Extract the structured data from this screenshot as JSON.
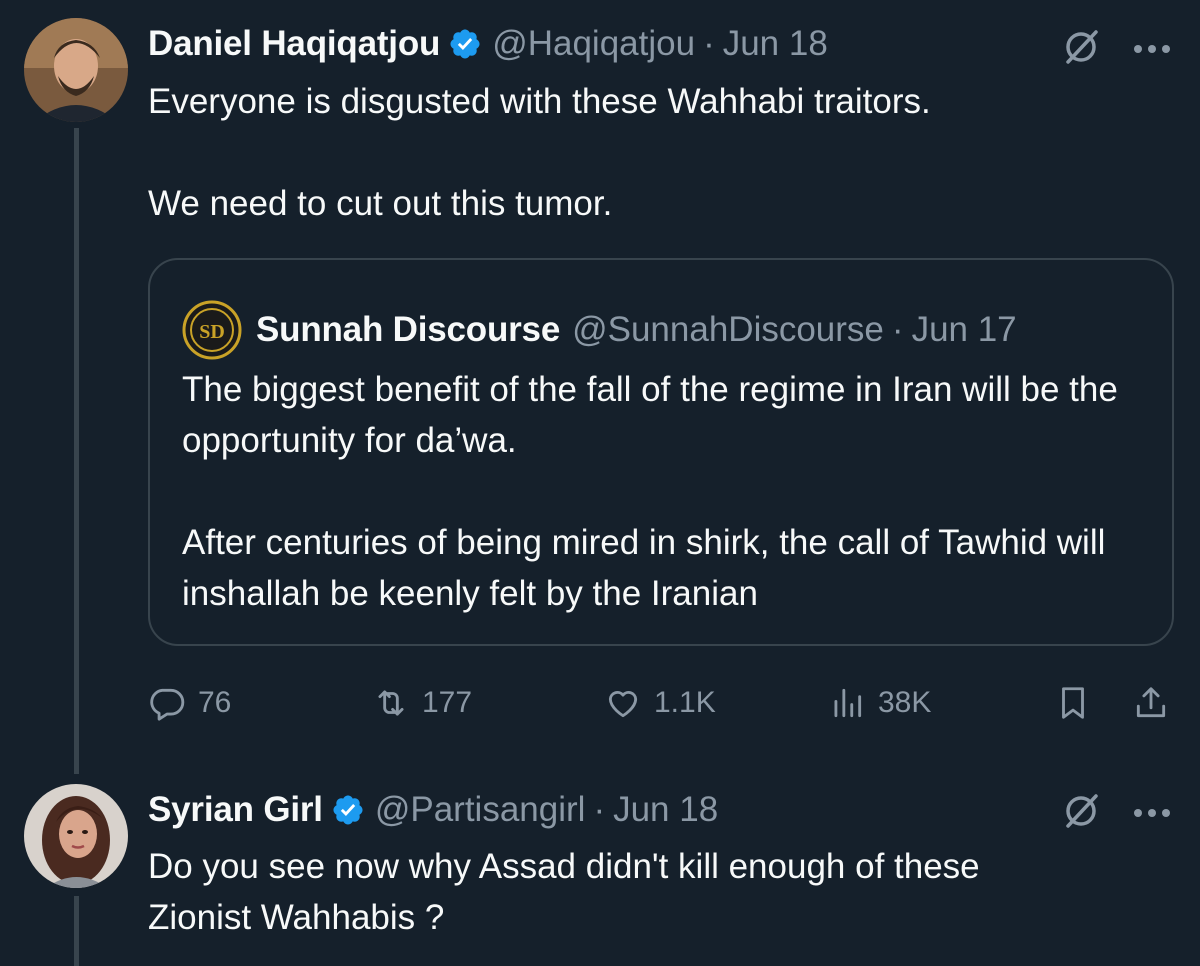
{
  "tweets": [
    {
      "name": "Daniel Haqiqatjou",
      "handle": "@Haqiqatjou",
      "separator": "·",
      "date": "Jun 18",
      "text": "Everyone is disgusted with these Wahhabi traitors.\n\nWe need to cut out this tumor.",
      "verified": true,
      "quote": {
        "name": "Sunnah Discourse",
        "handle": "@SunnahDiscourse",
        "separator": "·",
        "date": "Jun 17",
        "avatar_text": "SD",
        "text": "The biggest benefit of the fall of the regime in Iran will be the opportunity for da’wa.\n\nAfter centuries of being mired in shirk, the call of Tawhid will inshallah be keenly felt by the Iranian"
      },
      "actions": {
        "replies": "76",
        "reposts": "177",
        "likes": "1.1K",
        "views": "38K"
      }
    },
    {
      "name": "Syrian Girl",
      "handle": "@Partisangirl",
      "separator": "·",
      "date": "Jun 18",
      "text": "Do you see now why Assad didn't kill enough of these\nZionist Wahhabis ?",
      "verified": true
    }
  ],
  "icons": {
    "verified": "verified-badge-icon",
    "grok": "grok-icon",
    "more": "more-icon",
    "reply": "reply-icon",
    "repost": "repost-icon",
    "like": "heart-icon",
    "views": "views-icon",
    "bookmark": "bookmark-icon",
    "share": "share-icon"
  },
  "colors": {
    "background": "#15202b",
    "text": "#f7f9f9",
    "secondary": "#8b98a5",
    "border": "#38444d",
    "verified": "#1d9bf0",
    "quote_avatar": "#c9a227"
  }
}
